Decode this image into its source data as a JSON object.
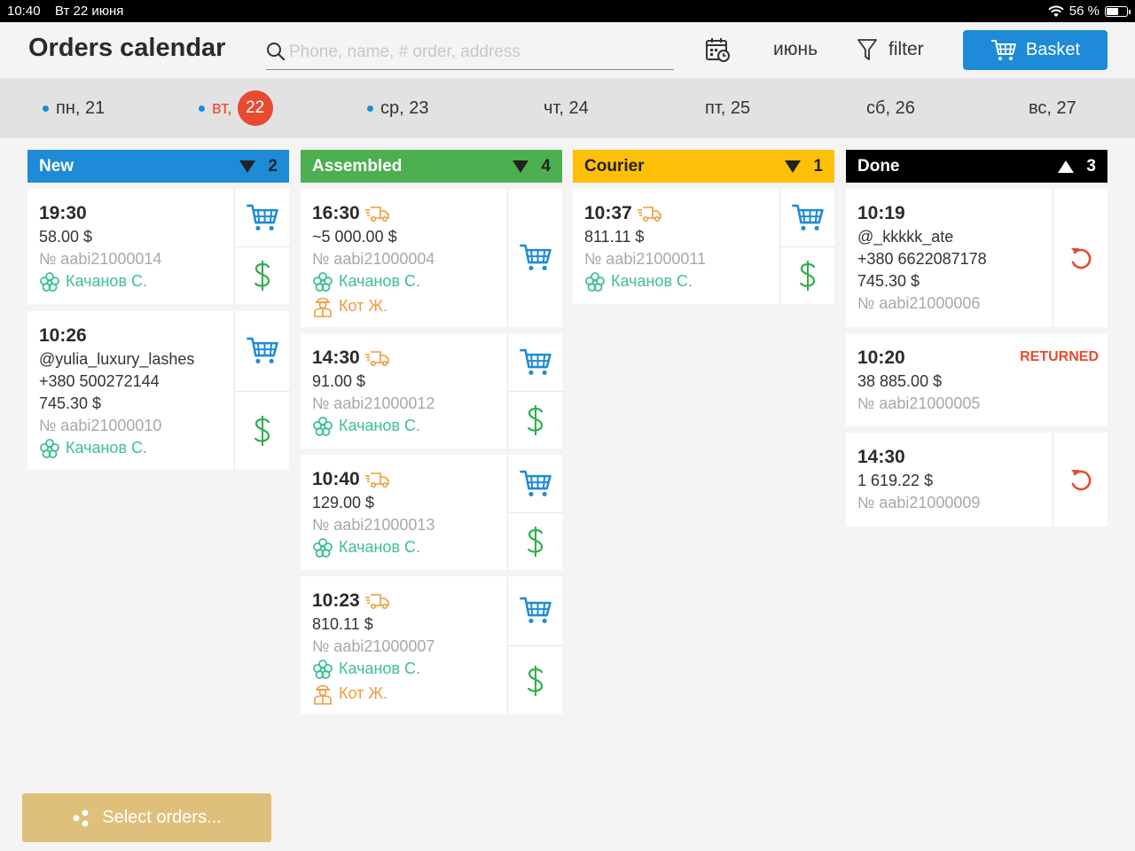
{
  "status": {
    "time": "10:40",
    "date": "Вт 22 июня",
    "battery": "56 %",
    "battery_level": 0.56
  },
  "header": {
    "title": "Orders calendar",
    "search_placeholder": "Phone, name, # order, address",
    "month": "июнь",
    "filter": "filter",
    "basket": "Basket"
  },
  "days": [
    {
      "label": "пн, 21",
      "dot": true,
      "today": false
    },
    {
      "label": "вт,",
      "num": "22",
      "dot": true,
      "today": true
    },
    {
      "label": "ср, 23",
      "dot": true,
      "today": false
    },
    {
      "label": "чт, 24",
      "dot": false,
      "today": false
    },
    {
      "label": "пт, 25",
      "dot": false,
      "today": false
    },
    {
      "label": "сб, 26",
      "dot": false,
      "today": false
    },
    {
      "label": "вс, 27",
      "dot": false,
      "today": false
    }
  ],
  "columns": [
    {
      "title": "New",
      "count": "2",
      "color": "#1d8bd7",
      "text_color": "#ffffff",
      "sort": "down"
    },
    {
      "title": "Assembled",
      "count": "4",
      "color": "#4caf50",
      "text_color": "#ffffff",
      "sort": "down"
    },
    {
      "title": "Courier",
      "count": "1",
      "color": "#fdc007",
      "text_color": "#222222",
      "sort": "down"
    },
    {
      "title": "Done",
      "count": "3",
      "color": "#000000",
      "text_color": "#ffffff",
      "sort": "up"
    }
  ],
  "cards": {
    "new": [
      {
        "time": "19:30",
        "amount": "58.00 $",
        "number": "№ aabi21000014",
        "manager": "Качанов С."
      },
      {
        "time": "10:26",
        "customer": "@yulia_luxury_lashes",
        "phone": "+380 500272144",
        "amount": "745.30 $",
        "number": "№ aabi21000010",
        "manager": "Качанов С."
      }
    ],
    "assembled": [
      {
        "time": "16:30",
        "amount": "~5 000.00 $",
        "number": "№ aabi21000004",
        "manager": "Качанов С.",
        "courier": "Кот Ж."
      },
      {
        "time": "14:30",
        "amount": "91.00 $",
        "number": "№ aabi21000012",
        "manager": "Качанов С."
      },
      {
        "time": "10:40",
        "amount": "129.00 $",
        "number": "№ aabi21000013",
        "manager": "Качанов С."
      },
      {
        "time": "10:23",
        "amount": "810.11 $",
        "number": "№ aabi21000007",
        "manager": "Качанов С.",
        "courier": "Кот Ж."
      }
    ],
    "courier": [
      {
        "time": "10:37",
        "amount": "811.11 $",
        "number": "№ aabi21000011",
        "manager": "Качанов С."
      }
    ],
    "done": [
      {
        "time": "10:19",
        "customer": "@_kkkkk_ate",
        "phone": "+380 6622087178",
        "amount": "745.30 $",
        "number": "№ aabi21000006"
      },
      {
        "time": "10:20",
        "status": "RETURNED",
        "amount": "38 885.00 $",
        "number": "№ aabi21000005"
      },
      {
        "time": "14:30",
        "amount": "1 619.22 $",
        "number": "№ aabi21000009"
      }
    ]
  },
  "select_orders": "Select orders...",
  "colors": {
    "accent": "#1d8bd7",
    "money": "#2eae4c",
    "manager": "#3bbf96",
    "courier": "#ef9b3a",
    "returned": "#e84a2f"
  }
}
